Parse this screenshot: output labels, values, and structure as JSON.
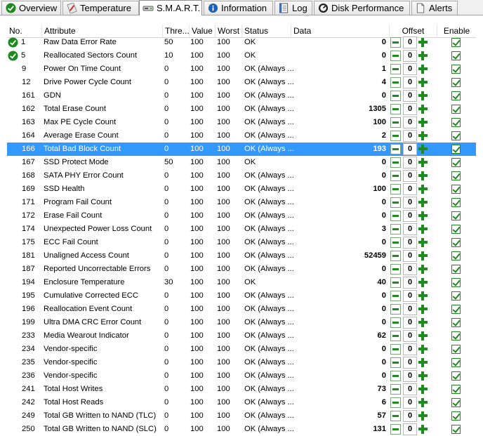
{
  "tabs": [
    {
      "label": "Overview",
      "icon": "check-circle-icon"
    },
    {
      "label": "Temperature",
      "icon": "thermometer-icon"
    },
    {
      "label": "S.M.A.R.T.",
      "icon": "drive-icon"
    },
    {
      "label": "Information",
      "icon": "info-icon"
    },
    {
      "label": "Log",
      "icon": "log-icon"
    },
    {
      "label": "Disk Performance",
      "icon": "gauge-icon"
    },
    {
      "label": "Alerts",
      "icon": "alerts-icon"
    }
  ],
  "columns": {
    "no": "No.",
    "attribute": "Attribute",
    "threshold": "Thre...",
    "value": "Value",
    "worst": "Worst",
    "status": "Status",
    "data": "Data",
    "offset": "Offset",
    "enable": "Enable"
  },
  "colors": {
    "selected": "#3399ff",
    "ok_green": "#1f8a1f"
  },
  "rows": [
    {
      "no": "1",
      "attr": "Raw Data Error Rate",
      "thr": "50",
      "val": "100",
      "worst": "100",
      "status": "OK",
      "data": "0",
      "offset": "0",
      "icon": true
    },
    {
      "no": "5",
      "attr": "Reallocated Sectors Count",
      "thr": "10",
      "val": "100",
      "worst": "100",
      "status": "OK",
      "data": "0",
      "offset": "0",
      "icon": true
    },
    {
      "no": "9",
      "attr": "Power On Time Count",
      "thr": "0",
      "val": "100",
      "worst": "100",
      "status": "OK (Always ...",
      "data": "1",
      "offset": "0"
    },
    {
      "no": "12",
      "attr": "Drive Power Cycle Count",
      "thr": "0",
      "val": "100",
      "worst": "100",
      "status": "OK (Always ...",
      "data": "4",
      "offset": "0"
    },
    {
      "no": "161",
      "attr": "GDN",
      "thr": "0",
      "val": "100",
      "worst": "100",
      "status": "OK (Always ...",
      "data": "0",
      "offset": "0"
    },
    {
      "no": "162",
      "attr": "Total Erase Count",
      "thr": "0",
      "val": "100",
      "worst": "100",
      "status": "OK (Always ...",
      "data": "1305",
      "offset": "0"
    },
    {
      "no": "163",
      "attr": "Max PE Cycle Count",
      "thr": "0",
      "val": "100",
      "worst": "100",
      "status": "OK (Always ...",
      "data": "100",
      "offset": "0"
    },
    {
      "no": "164",
      "attr": "Average Erase Count",
      "thr": "0",
      "val": "100",
      "worst": "100",
      "status": "OK (Always ...",
      "data": "2",
      "offset": "0"
    },
    {
      "no": "166",
      "attr": "Total Bad Block Count",
      "thr": "0",
      "val": "100",
      "worst": "100",
      "status": "OK (Always ...",
      "data": "193",
      "offset": "0",
      "selected": true
    },
    {
      "no": "167",
      "attr": "SSD Protect Mode",
      "thr": "50",
      "val": "100",
      "worst": "100",
      "status": "OK",
      "data": "0",
      "offset": "0"
    },
    {
      "no": "168",
      "attr": "SATA PHY Error Count",
      "thr": "0",
      "val": "100",
      "worst": "100",
      "status": "OK (Always ...",
      "data": "0",
      "offset": "0"
    },
    {
      "no": "169",
      "attr": "SSD Health",
      "thr": "0",
      "val": "100",
      "worst": "100",
      "status": "OK (Always ...",
      "data": "100",
      "offset": "0"
    },
    {
      "no": "171",
      "attr": "Program Fail Count",
      "thr": "0",
      "val": "100",
      "worst": "100",
      "status": "OK (Always ...",
      "data": "0",
      "offset": "0"
    },
    {
      "no": "172",
      "attr": "Erase Fail Count",
      "thr": "0",
      "val": "100",
      "worst": "100",
      "status": "OK (Always ...",
      "data": "0",
      "offset": "0"
    },
    {
      "no": "174",
      "attr": "Unexpected Power Loss Count",
      "thr": "0",
      "val": "100",
      "worst": "100",
      "status": "OK (Always ...",
      "data": "3",
      "offset": "0"
    },
    {
      "no": "175",
      "attr": "ECC Fail Count",
      "thr": "0",
      "val": "100",
      "worst": "100",
      "status": "OK (Always ...",
      "data": "0",
      "offset": "0"
    },
    {
      "no": "181",
      "attr": "Unaligned Access Count",
      "thr": "0",
      "val": "100",
      "worst": "100",
      "status": "OK (Always ...",
      "data": "52459",
      "offset": "0"
    },
    {
      "no": "187",
      "attr": "Reported Uncorrectable Errors",
      "thr": "0",
      "val": "100",
      "worst": "100",
      "status": "OK (Always ...",
      "data": "0",
      "offset": "0"
    },
    {
      "no": "194",
      "attr": "Enclosure Temperature",
      "thr": "30",
      "val": "100",
      "worst": "100",
      "status": "OK",
      "data": "40",
      "offset": "0"
    },
    {
      "no": "195",
      "attr": "Cumulative Corrected ECC",
      "thr": "0",
      "val": "100",
      "worst": "100",
      "status": "OK (Always ...",
      "data": "0",
      "offset": "0"
    },
    {
      "no": "196",
      "attr": "Reallocation Event Count",
      "thr": "0",
      "val": "100",
      "worst": "100",
      "status": "OK (Always ...",
      "data": "0",
      "offset": "0"
    },
    {
      "no": "199",
      "attr": "Ultra DMA CRC Error Count",
      "thr": "0",
      "val": "100",
      "worst": "100",
      "status": "OK (Always ...",
      "data": "0",
      "offset": "0"
    },
    {
      "no": "233",
      "attr": "Media Wearout Indicator",
      "thr": "0",
      "val": "100",
      "worst": "100",
      "status": "OK (Always ...",
      "data": "62",
      "offset": "0"
    },
    {
      "no": "234",
      "attr": "Vendor-specific",
      "thr": "0",
      "val": "100",
      "worst": "100",
      "status": "OK (Always ...",
      "data": "0",
      "offset": "0"
    },
    {
      "no": "235",
      "attr": "Vendor-specific",
      "thr": "0",
      "val": "100",
      "worst": "100",
      "status": "OK (Always ...",
      "data": "0",
      "offset": "0"
    },
    {
      "no": "236",
      "attr": "Vendor-specific",
      "thr": "0",
      "val": "100",
      "worst": "100",
      "status": "OK (Always ...",
      "data": "0",
      "offset": "0"
    },
    {
      "no": "241",
      "attr": "Total Host Writes",
      "thr": "0",
      "val": "100",
      "worst": "100",
      "status": "OK (Always ...",
      "data": "73",
      "offset": "0"
    },
    {
      "no": "242",
      "attr": "Total Host Reads",
      "thr": "0",
      "val": "100",
      "worst": "100",
      "status": "OK (Always ...",
      "data": "6",
      "offset": "0"
    },
    {
      "no": "249",
      "attr": "Total GB Written to NAND (TLC)",
      "thr": "0",
      "val": "100",
      "worst": "100",
      "status": "OK (Always ...",
      "data": "57",
      "offset": "0"
    },
    {
      "no": "250",
      "attr": "Total GB Written to NAND (SLC)",
      "thr": "0",
      "val": "100",
      "worst": "100",
      "status": "OK (Always ...",
      "data": "131",
      "offset": "0"
    }
  ]
}
